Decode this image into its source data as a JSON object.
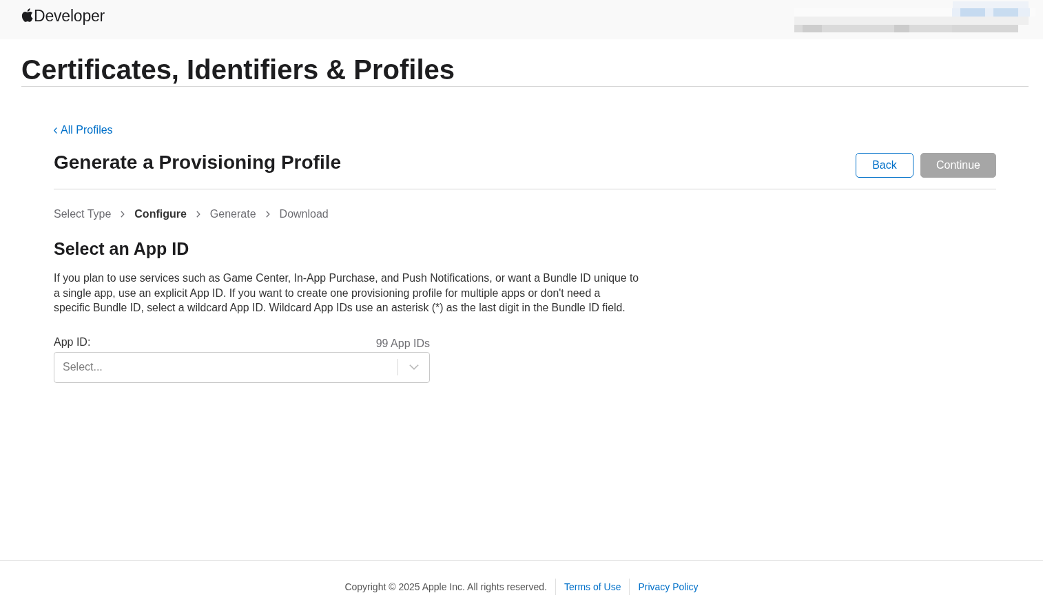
{
  "header": {
    "logo_text": "Developer"
  },
  "page_title": "Certificates, Identifiers & Profiles",
  "back_link": {
    "label": "All Profiles"
  },
  "heading": "Generate a Provisioning Profile",
  "buttons": [
    {
      "label": "Back",
      "kind": "secondary",
      "disabled": false
    },
    {
      "label": "Continue",
      "kind": "primary",
      "disabled": true
    }
  ],
  "steps": [
    {
      "label": "Select Type",
      "current": false
    },
    {
      "label": "Configure",
      "current": true
    },
    {
      "label": "Generate",
      "current": false
    },
    {
      "label": "Download",
      "current": false
    }
  ],
  "section": {
    "title": "Select an App ID",
    "description": "If you plan to use services such as Game Center, In-App Purchase, and Push Notifications, or want a Bundle ID unique to a single app, use an explicit App ID. If you want to create one provisioning profile for multiple apps or don't need a specific Bundle ID, select a wildcard App ID. Wildcard App IDs use an asterisk (*) as the last digit in the Bundle ID field."
  },
  "app_id_field": {
    "label": "App ID:",
    "count": "99 App IDs",
    "placeholder": "Select..."
  },
  "footer": {
    "copyright": "Copyright © 2025 Apple Inc. All rights reserved.",
    "links": [
      "Terms of Use",
      "Privacy Policy"
    ]
  }
}
